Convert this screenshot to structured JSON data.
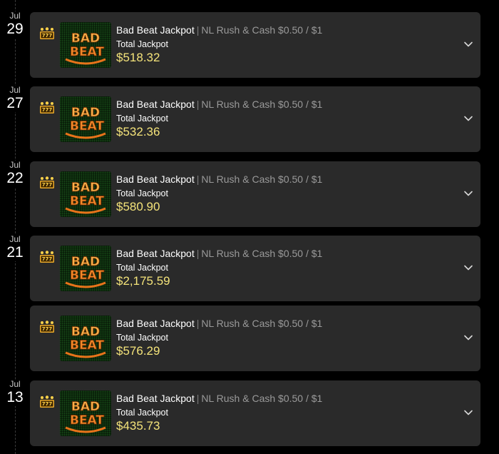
{
  "entries": [
    {
      "month": "Jul",
      "day": "29",
      "name": "Bad Beat Jackpot",
      "separator": "|",
      "game": "NL Rush & Cash $0.50 / $1",
      "label": "Total Jackpot",
      "amount": "$518.32"
    },
    {
      "month": "Jul",
      "day": "27",
      "name": "Bad Beat Jackpot",
      "separator": "|",
      "game": "NL Rush & Cash $0.50 / $1",
      "label": "Total Jackpot",
      "amount": "$532.36"
    },
    {
      "month": "Jul",
      "day": "22",
      "name": "Bad Beat Jackpot",
      "separator": "|",
      "game": "NL Rush & Cash $0.50 / $1",
      "label": "Total Jackpot",
      "amount": "$580.90"
    },
    {
      "month": "Jul",
      "day": "21",
      "name": "Bad Beat Jackpot",
      "separator": "|",
      "game": "NL Rush & Cash $0.50 / $1",
      "label": "Total Jackpot",
      "amount": "$2,175.59"
    },
    {
      "month": "",
      "day": "",
      "name": "Bad Beat Jackpot",
      "separator": "|",
      "game": "NL Rush & Cash $0.50 / $1",
      "label": "Total Jackpot",
      "amount": "$576.29"
    },
    {
      "month": "Jul",
      "day": "13",
      "name": "Bad Beat Jackpot",
      "separator": "|",
      "game": "NL Rush & Cash $0.50 / $1",
      "label": "Total Jackpot",
      "amount": "$435.73"
    }
  ],
  "thumbnail": {
    "line1": "BAD",
    "line2": "BEAT"
  },
  "icons": {
    "game_type": "slot-777-icon",
    "expand": "chevron-down-icon"
  },
  "colors": {
    "background": "#000000",
    "card": "#2a2a2a",
    "amount": "#f4e37a",
    "logo_orange": "#e8731a"
  }
}
